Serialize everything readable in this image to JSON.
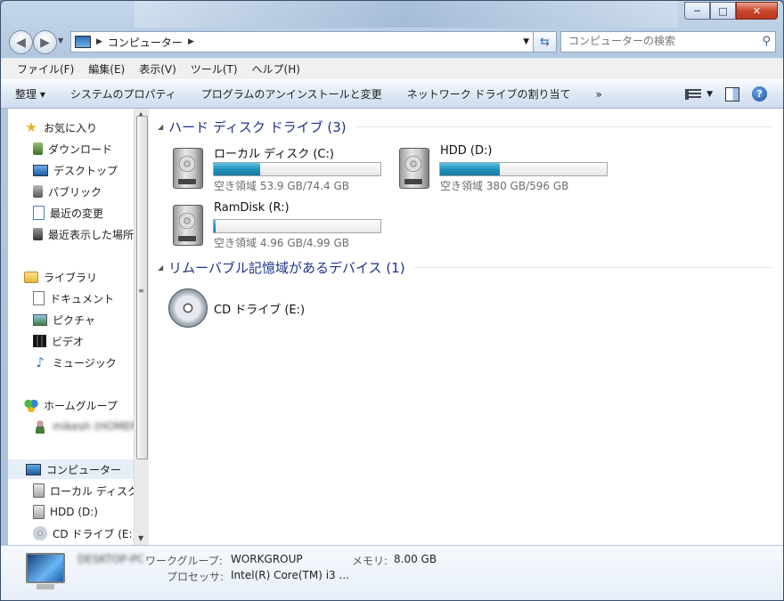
{
  "window": {
    "minimize": "─",
    "maximize": "□",
    "close": "✕"
  },
  "address": {
    "path": "コンピューター",
    "search_placeholder": "コンピューターの検索"
  },
  "menu": [
    "ファイル(F)",
    "編集(E)",
    "表示(V)",
    "ツール(T)",
    "ヘルプ(H)"
  ],
  "commands": [
    "整理 ▾",
    "システムのプロパティ",
    "プログラムのアンインストールと変更",
    "ネットワーク ドライブの割り当て",
    "»"
  ],
  "nav": {
    "favorites": "お気に入り",
    "fav_items": [
      "ダウンロード",
      "デスクトップ",
      "パブリック",
      "最近の変更",
      "最近表示した場所"
    ],
    "libraries": "ライブラリ",
    "lib_items": [
      "ドキュメント",
      "ピクチャ",
      "ビデオ",
      "ミュージック"
    ],
    "homegroup": "ホームグループ",
    "homegroup_user": "mikesh (HOMEPC)",
    "computer": "コンピューター",
    "computer_items": [
      "ローカル ディスク (C:)",
      "HDD (D:)",
      "CD ドライブ (E:)"
    ]
  },
  "groups": {
    "hdd_header": "ハード ディスク ドライブ (3)",
    "removable_header": "リムーバブル記憶域があるデバイス (1)"
  },
  "drives": [
    {
      "name": "ローカル ディスク (C:)",
      "free": "空き領域 53.9 GB/74.4 GB",
      "used_fraction": 0.28
    },
    {
      "name": "HDD (D:)",
      "free": "空き領域 380 GB/596 GB",
      "used_fraction": 0.36
    },
    {
      "name": "RamDisk (R:)",
      "free": "空き領域 4.96 GB/4.99 GB",
      "used_fraction": 0.01
    }
  ],
  "cd": {
    "name": "CD ドライブ (E:)"
  },
  "details": {
    "pc_name": "DESKTOP-PC",
    "workgroup_label": "ワークグループ:",
    "workgroup_value": "WORKGROUP",
    "memory_label": "メモリ:",
    "memory_value": "8.00 GB",
    "processor_label": "プロセッサ:",
    "processor_value": "Intel(R) Core(TM) i3 ..."
  },
  "colors": {
    "accent_header": "#1e3287",
    "drive_fill": "#1f90b9"
  }
}
